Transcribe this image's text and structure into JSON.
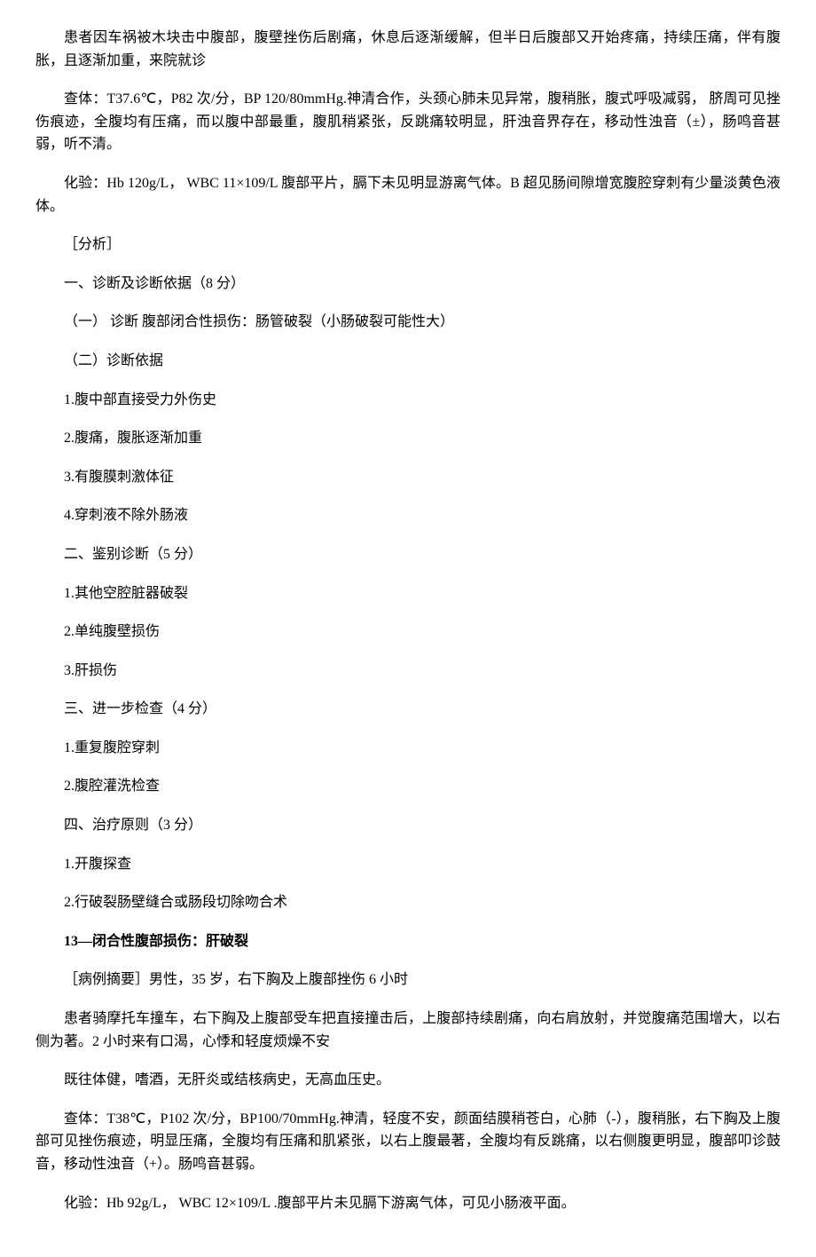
{
  "case12": {
    "history": "患者因车祸被木块击中腹部，腹壁挫伤后剧痛，休息后逐渐缓解，但半日后腹部又开始疼痛，持续压痛，伴有腹胀，且逐渐加重，来院就诊",
    "exam": "查体：T37.6℃，P82 次/分，BP 120/80mmHg.神清合作，头颈心肺未见异常，腹稍胀，腹式呼吸减弱， 脐周可见挫伤痕迹，全腹均有压痛，而以腹中部最重，腹肌稍紧张，反跳痛较明显，肝浊音界存在，移动性浊音（±），肠鸣音甚弱，听不清。",
    "lab": "化验：Hb 120g/L，  WBC 11×109/L  腹部平片，膈下未见明显游离气体。B 超见肠间隙增宽腹腔穿刺有少量淡黄色液体。",
    "analysis_label": "［分析］",
    "section1_title": "一、诊断及诊断依据（8 分）",
    "diagnosis1": "（一） 诊断  腹部闭合性损伤：肠管破裂（小肠破裂可能性大）",
    "diagnosis2": "（二）诊断依据",
    "basis1": "1.腹中部直接受力外伤史",
    "basis2": "2.腹痛，腹胀逐渐加重",
    "basis3": "3.有腹膜刺激体征",
    "basis4": "4.穿刺液不除外肠液",
    "section2_title": "二、鉴别诊断（5 分）",
    "diff1": "1.其他空腔脏器破裂",
    "diff2": "2.单纯腹壁损伤",
    "diff3": "3.肝损伤",
    "section3_title": "三、进一步检查（4 分）",
    "check1": "1.重复腹腔穿刺",
    "check2": "2.腹腔灌洗检查",
    "section4_title": "四、治疗原则（3 分）",
    "treat1": "1.开腹探查",
    "treat2": "2.行破裂肠壁缝合或肠段切除吻合术"
  },
  "case13": {
    "title": "13—闭合性腹部损伤：肝破裂",
    "summary": "［病例摘要］男性，35 岁，右下胸及上腹部挫伤 6 小时",
    "history": "患者骑摩托车撞车，右下胸及上腹部受车把直接撞击后，上腹部持续剧痛，向右肩放射，并觉腹痛范围增大，以右侧为著。2 小时来有口渴，心悸和轻度烦燥不安",
    "past": "既往体健，嗜酒，无肝炎或结核病史，无高血压史。",
    "exam": "查体：T38℃，P102 次/分，BP100/70mmHg.神清，轻度不安，颜面结膜稍苍白，心肺（-），腹稍胀，右下胸及上腹部可见挫伤痕迹，明显压痛，全腹均有压痛和肌紧张，以右上腹最著，全腹均有反跳痛，以右侧腹更明显，腹部叩诊鼓音，移动性浊音（+）。肠鸣音甚弱。",
    "lab": "化验：Hb 92g/L，  WBC 12×109/L .腹部平片未见膈下游离气体，可见小肠液平面。"
  }
}
